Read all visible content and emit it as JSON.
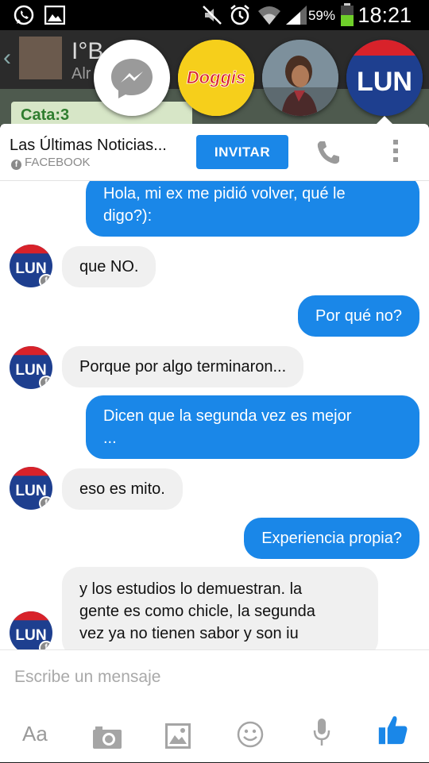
{
  "status_bar": {
    "battery_percent": "59%",
    "time": "18:21",
    "icons": [
      "whatsapp-icon",
      "image-icon",
      "mute-icon",
      "alarm-icon",
      "wifi-icon",
      "signal-icon",
      "battery-icon"
    ]
  },
  "background_app": {
    "title": "I°B",
    "subtitle": "Alr",
    "tag": "Cata:3"
  },
  "chat_heads": [
    "messenger",
    "doggis",
    "person",
    "lun"
  ],
  "doggis_logo_text": "Doggis",
  "lun_logo_text": "LUN",
  "conversation": {
    "name": "Las Últimas Noticias...",
    "source": "FACEBOOK",
    "invite_label": "INVITAR"
  },
  "messages": [
    {
      "from": "me",
      "lines": [
        "Hola, mi ex me pidió volver, qué le",
        "digo?):"
      ]
    },
    {
      "from": "them",
      "lines": [
        "que NO."
      ]
    },
    {
      "from": "me",
      "lines": [
        "Por qué no?"
      ]
    },
    {
      "from": "them",
      "lines": [
        "Porque por algo terminaron..."
      ]
    },
    {
      "from": "me",
      "lines": [
        "Dicen que la segunda vez es mejor",
        "..."
      ]
    },
    {
      "from": "them",
      "lines": [
        "eso es mito."
      ]
    },
    {
      "from": "me",
      "lines": [
        "Experiencia propia?"
      ]
    },
    {
      "from": "them",
      "lines": [
        "y los estudios lo demuestran. la",
        "gente es como chicle, la segunda",
        "vez ya no tienen sabor y son iu"
      ]
    }
  ],
  "composer": {
    "placeholder": "Escribe un mensaje",
    "text_button_label": "Aa"
  },
  "colors": {
    "accent": "#1a87e8",
    "incoming_bubble": "#f0f0f0",
    "lun_blue": "#1e3f8f",
    "lun_red": "#d8222a"
  }
}
